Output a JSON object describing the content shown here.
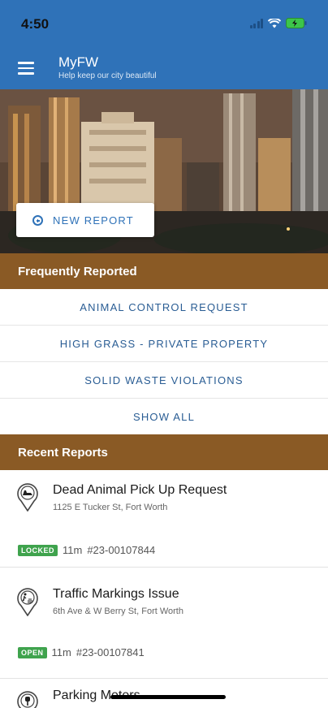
{
  "status_bar": {
    "time": "4:50"
  },
  "app_bar": {
    "title": "MyFW",
    "subtitle": "Help keep our city beautiful"
  },
  "hero": {
    "new_report_label": "NEW REPORT"
  },
  "frequently_reported": {
    "header": "Frequently Reported",
    "items": [
      {
        "label": "ANIMAL CONTROL REQUEST"
      },
      {
        "label": "HIGH GRASS - PRIVATE PROPERTY"
      },
      {
        "label": "SOLID WASTE VIOLATIONS"
      },
      {
        "label": "SHOW ALL"
      }
    ]
  },
  "recent_reports": {
    "header": "Recent Reports",
    "items": [
      {
        "icon": "dead-animal-icon",
        "title": "Dead Animal Pick Up Request",
        "address": "1125 E Tucker St, Fort Worth",
        "status": "LOCKED",
        "age": "11m",
        "number": "#23-00107844"
      },
      {
        "icon": "traffic-marking-icon",
        "title": "Traffic Markings Issue",
        "address": "6th Ave & W Berry St, Fort Worth",
        "status": "OPEN",
        "age": "11m",
        "number": "#23-00107841"
      },
      {
        "icon": "parking-meter-icon",
        "title": "Parking Meters",
        "address": "",
        "status": "",
        "age": "",
        "number": ""
      }
    ]
  },
  "colors": {
    "app_bar": "#2f72b8",
    "section_header": "#8a5a25",
    "link": "#2a5d94",
    "badge": "#3fa34d"
  }
}
